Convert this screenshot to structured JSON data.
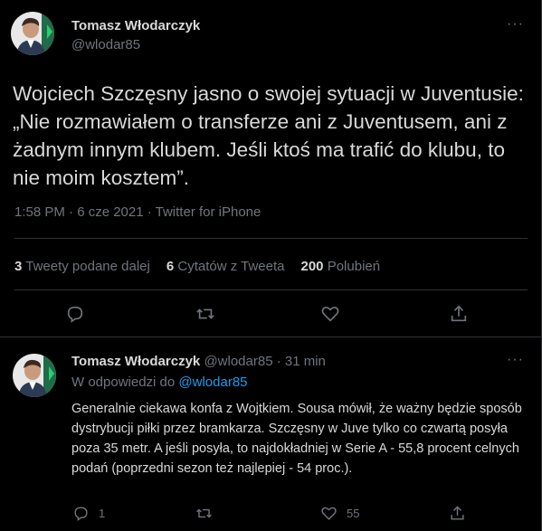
{
  "main_tweet": {
    "author_name": "Tomasz Włodarczyk",
    "author_handle": "@wlodar85",
    "text": "Wojciech Szczęsny jasno o swojej sytuacji w Juventusie: „Nie rozmawiałem o transferze ani z Juventusem, ani z żadnym innym klubem. Jeśli ktoś ma trafić do klubu, to nie moim kosztem”.",
    "timestamp": "1:58 PM · 6 cze 2021 · Twitter for iPhone",
    "stats": {
      "retweets_count": "3",
      "retweets_label": "Tweety podane dalej",
      "quotes_count": "6",
      "quotes_label": "Cytatów z Tweeta",
      "likes_count": "200",
      "likes_label": "Polubień"
    },
    "actions": [
      "reply-icon",
      "retweet-icon",
      "like-icon",
      "share-icon"
    ]
  },
  "reply_tweet": {
    "author_name": "Tomasz Włodarczyk",
    "author_handle": "@wlodar85",
    "time_ago": "· 31 min",
    "replying_to_label": "W odpowiedzi do",
    "replying_to_handle": "@wlodar85",
    "text": "Generalnie ciekawa konfa z Wojtkiem. Sousa mówił, że ważny będzie sposób dystrybucji piłki przez bramkarza. Szczęsny w Juve tylko co czwartą posyła poza 35 metr. A jeśli posyła, to najdokładniej w Serie A - 55,8 procent celnych podań (poprzedni sezon też najlepiej - 54 proc.).",
    "reply_count": "1",
    "like_count": "55"
  },
  "colors": {
    "background": "#000000",
    "text": "#d9d9d9",
    "muted": "#6e767d",
    "link": "#1d9bf0",
    "divider": "#2f3336"
  }
}
